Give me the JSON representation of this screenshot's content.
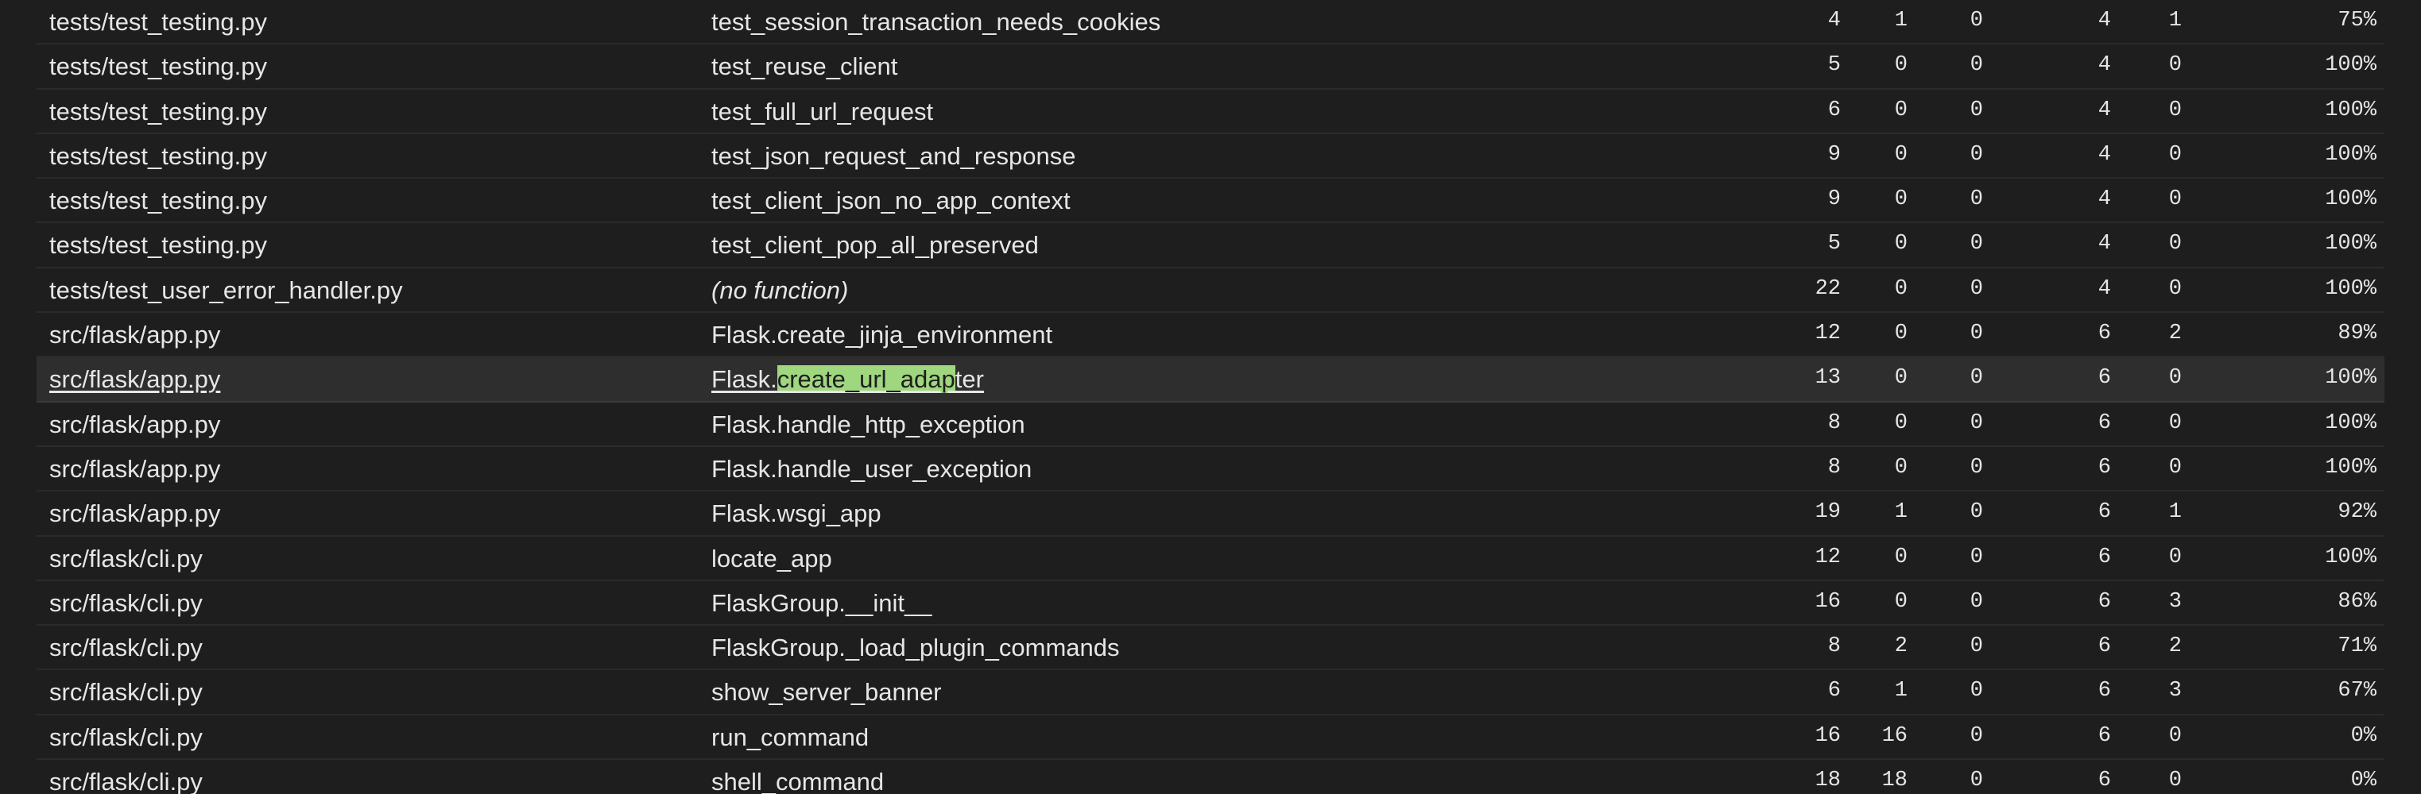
{
  "accent": {
    "row_highlight": "#2e2e2e",
    "selection_green": "#9fd77f"
  },
  "rows": [
    {
      "file": "tests/test_testing.py",
      "function": "test_session_transaction_needs_cookies",
      "statements": "4",
      "missing": "1",
      "excluded": "0",
      "branches": "4",
      "partial": "1",
      "coverage": "75%"
    },
    {
      "file": "tests/test_testing.py",
      "function": "test_reuse_client",
      "statements": "5",
      "missing": "0",
      "excluded": "0",
      "branches": "4",
      "partial": "0",
      "coverage": "100%"
    },
    {
      "file": "tests/test_testing.py",
      "function": "test_full_url_request",
      "statements": "6",
      "missing": "0",
      "excluded": "0",
      "branches": "4",
      "partial": "0",
      "coverage": "100%"
    },
    {
      "file": "tests/test_testing.py",
      "function": "test_json_request_and_response",
      "statements": "9",
      "missing": "0",
      "excluded": "0",
      "branches": "4",
      "partial": "0",
      "coverage": "100%"
    },
    {
      "file": "tests/test_testing.py",
      "function": "test_client_json_no_app_context",
      "statements": "9",
      "missing": "0",
      "excluded": "0",
      "branches": "4",
      "partial": "0",
      "coverage": "100%"
    },
    {
      "file": "tests/test_testing.py",
      "function": "test_client_pop_all_preserved",
      "statements": "5",
      "missing": "0",
      "excluded": "0",
      "branches": "4",
      "partial": "0",
      "coverage": "100%"
    },
    {
      "file": "tests/test_user_error_handler.py",
      "function": "(no function)",
      "statements": "22",
      "missing": "0",
      "excluded": "0",
      "branches": "4",
      "partial": "0",
      "coverage": "100%"
    },
    {
      "file": "src/flask/app.py",
      "function": "Flask.create_jinja_environment",
      "statements": "12",
      "missing": "0",
      "excluded": "0",
      "branches": "6",
      "partial": "2",
      "coverage": "89%"
    },
    {
      "file": "src/flask/app.py",
      "function_prefix": "Flask.",
      "function_selected": "create_url_adap",
      "function_suffix": "ter",
      "statements": "13",
      "missing": "0",
      "excluded": "0",
      "branches": "6",
      "partial": "0",
      "coverage": "100%"
    },
    {
      "file": "src/flask/app.py",
      "function": "Flask.handle_http_exception",
      "statements": "8",
      "missing": "0",
      "excluded": "0",
      "branches": "6",
      "partial": "0",
      "coverage": "100%"
    },
    {
      "file": "src/flask/app.py",
      "function": "Flask.handle_user_exception",
      "statements": "8",
      "missing": "0",
      "excluded": "0",
      "branches": "6",
      "partial": "0",
      "coverage": "100%"
    },
    {
      "file": "src/flask/app.py",
      "function": "Flask.wsgi_app",
      "statements": "19",
      "missing": "1",
      "excluded": "0",
      "branches": "6",
      "partial": "1",
      "coverage": "92%"
    },
    {
      "file": "src/flask/cli.py",
      "function": "locate_app",
      "statements": "12",
      "missing": "0",
      "excluded": "0",
      "branches": "6",
      "partial": "0",
      "coverage": "100%"
    },
    {
      "file": "src/flask/cli.py",
      "function": "FlaskGroup.__init__",
      "statements": "16",
      "missing": "0",
      "excluded": "0",
      "branches": "6",
      "partial": "3",
      "coverage": "86%"
    },
    {
      "file": "src/flask/cli.py",
      "function": "FlaskGroup._load_plugin_commands",
      "statements": "8",
      "missing": "2",
      "excluded": "0",
      "branches": "6",
      "partial": "2",
      "coverage": "71%"
    },
    {
      "file": "src/flask/cli.py",
      "function": "show_server_banner",
      "statements": "6",
      "missing": "1",
      "excluded": "0",
      "branches": "6",
      "partial": "3",
      "coverage": "67%"
    },
    {
      "file": "src/flask/cli.py",
      "function": "run_command",
      "statements": "16",
      "missing": "16",
      "excluded": "0",
      "branches": "6",
      "partial": "0",
      "coverage": "0%"
    },
    {
      "file": "src/flask/cli.py",
      "function": "shell_command",
      "statements": "18",
      "missing": "18",
      "excluded": "0",
      "branches": "6",
      "partial": "0",
      "coverage": "0%"
    }
  ]
}
